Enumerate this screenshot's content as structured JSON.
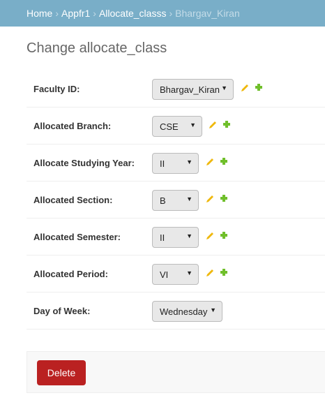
{
  "breadcrumbs": {
    "home": "Home",
    "app": "Appfr1",
    "model": "Allocate_classs",
    "current": "Bhargav_Kiran",
    "separator": "›"
  },
  "page_title": "Change allocate_class",
  "fields": [
    {
      "label": "Faculty ID:",
      "value": "Bhargav_Kiran",
      "has_actions": true
    },
    {
      "label": "Allocated Branch:",
      "value": "CSE",
      "has_actions": true
    },
    {
      "label": "Allocate Studying Year:",
      "value": "II",
      "has_actions": true
    },
    {
      "label": "Allocated Section:",
      "value": "B",
      "has_actions": true
    },
    {
      "label": "Allocated Semester:",
      "value": "II",
      "has_actions": true
    },
    {
      "label": "Allocated Period:",
      "value": "VI",
      "has_actions": true
    },
    {
      "label": "Day of Week:",
      "value": "Wednesday",
      "has_actions": false
    }
  ],
  "icons": {
    "caret": "▼",
    "edit": "pencil-icon",
    "add": "plus-icon"
  },
  "colors": {
    "header": "#79aec8",
    "delete": "#ba2121",
    "pencil": "#efb80b",
    "plus": "#70bf2b"
  },
  "actions": {
    "delete_label": "Delete"
  }
}
